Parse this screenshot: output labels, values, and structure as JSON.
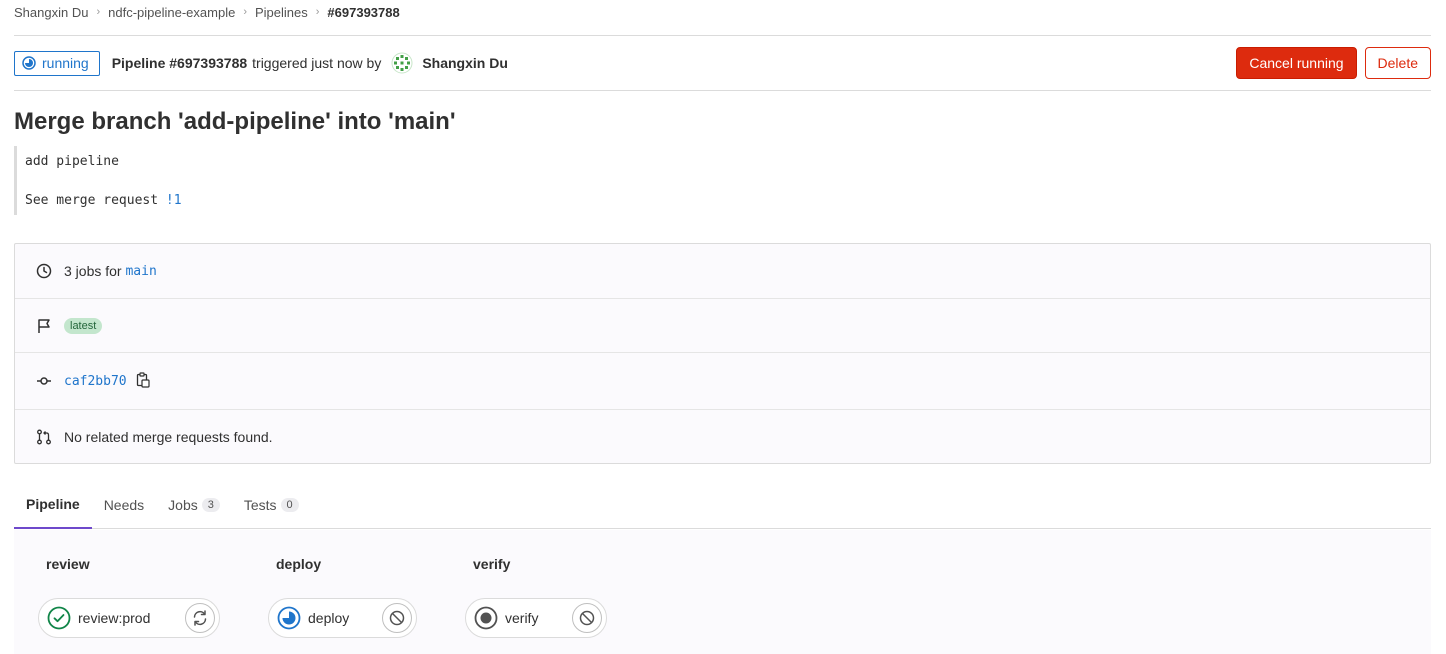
{
  "breadcrumb": {
    "items": [
      "Shangxin Du",
      "ndfc-pipeline-example",
      "Pipelines"
    ],
    "current": "#697393788"
  },
  "header": {
    "status": "running",
    "pipeline_id": "Pipeline #697393788",
    "triggered_text": "triggered just now by",
    "user": "Shangxin Du",
    "cancel_label": "Cancel running",
    "delete_label": "Delete"
  },
  "commit": {
    "title": "Merge branch 'add-pipeline' into 'main'",
    "body_line1": "add pipeline",
    "body_line2_prefix": "See merge request ",
    "mr_link": "!1"
  },
  "info": {
    "jobs_text": "3 jobs for",
    "branch": "main",
    "latest_badge": "latest",
    "sha": "caf2bb70",
    "no_mr_text": "No related merge requests found."
  },
  "tabs": [
    {
      "label": "Pipeline",
      "count": null
    },
    {
      "label": "Needs",
      "count": null
    },
    {
      "label": "Jobs",
      "count": "3"
    },
    {
      "label": "Tests",
      "count": "0"
    }
  ],
  "stages": [
    {
      "title": "review",
      "job": "review:prod",
      "job_status": "success",
      "action": "retry-icon"
    },
    {
      "title": "deploy",
      "job": "deploy",
      "job_status": "running",
      "action": "cancel-icon"
    },
    {
      "title": "verify",
      "job": "verify",
      "job_status": "created",
      "action": "cancel-icon"
    }
  ],
  "colors": {
    "accent_blue": "#1f75cb",
    "danger_red": "#dd2b0e",
    "success_green": "#108548",
    "tab_active": "#6e49cb"
  }
}
